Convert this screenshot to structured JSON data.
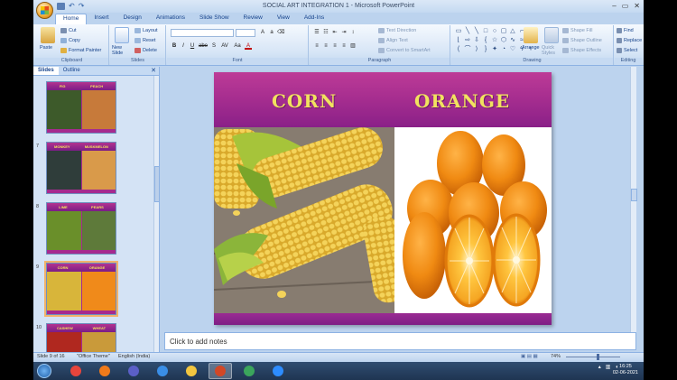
{
  "window": {
    "title": "SOCIAL ART INTEGRATION 1 - Microsoft PowerPoint",
    "controls": [
      "–",
      "▭",
      "✕"
    ]
  },
  "tabs": [
    "Home",
    "Insert",
    "Design",
    "Animations",
    "Slide Show",
    "Review",
    "View",
    "Add-Ins"
  ],
  "ribbon": {
    "clipboard": {
      "paste": "Paste",
      "cut": "Cut",
      "copy": "Copy",
      "format_painter": "Format Painter",
      "label": "Clipboard"
    },
    "slides": {
      "new_slide": "New Slide",
      "layout": "Layout",
      "reset": "Reset",
      "delete": "Delete",
      "label": "Slides"
    },
    "font": {
      "label": "Font",
      "bold": "B",
      "italic": "I",
      "underline": "U",
      "strike": "abe",
      "shadow": "S",
      "spacing": "AV",
      "case": "Aa",
      "color": "A"
    },
    "paragraph": {
      "label": "Paragraph",
      "text_direction": "Text Direction",
      "align_text": "Align Text",
      "convert_smartart": "Convert to SmartArt"
    },
    "drawing": {
      "label": "Drawing",
      "arrange": "Arrange",
      "quick_styles": "Quick Styles",
      "shape_fill": "Shape Fill",
      "shape_outline": "Shape Outline",
      "shape_effects": "Shape Effects"
    },
    "editing": {
      "label": "Editing",
      "find": "Find",
      "replace": "Replace",
      "select": "Select"
    }
  },
  "left_panel": {
    "tabs": [
      "Slides",
      "Outline"
    ],
    "thumbnails": [
      {
        "num": "",
        "left": "FIG",
        "right": "PEACH",
        "c1": "#3d5a2a",
        "c2": "#c77a3a"
      },
      {
        "num": "7",
        "left": "MONKEY",
        "right": "MUSKMELON",
        "c1": "#2f3d3a",
        "c2": "#d99a4a"
      },
      {
        "num": "8",
        "left": "LIME",
        "right": "PEARS",
        "c1": "#6a8f2a",
        "c2": "#5e7a3a"
      },
      {
        "num": "9",
        "left": "CORN",
        "right": "ORANGE",
        "c1": "#d8b53a",
        "c2": "#f08a1a"
      },
      {
        "num": "10",
        "left": "CASHEW",
        "right": "WHEAT",
        "c1": "#b0281f",
        "c2": "#c99a3a"
      }
    ]
  },
  "slide": {
    "title_left": "CORN",
    "title_right": "ORANGE"
  },
  "notes": {
    "placeholder": "Click to add notes"
  },
  "status": {
    "slide_info": "Slide 9 of 16",
    "theme": "\"Office Theme\"",
    "language": "English (India)",
    "zoom": "74%"
  },
  "taskbar": {
    "apps": [
      {
        "name": "chrome-icon",
        "color": "#e8453c"
      },
      {
        "name": "firefox-icon",
        "color": "#f07a1a"
      },
      {
        "name": "teams-icon",
        "color": "#5b5fc7"
      },
      {
        "name": "ie-icon",
        "color": "#3a8ee6"
      },
      {
        "name": "explorer-icon",
        "color": "#f2c640"
      },
      {
        "name": "powerpoint-icon",
        "color": "#d24726"
      },
      {
        "name": "chrome2-icon",
        "color": "#3ba55c"
      },
      {
        "name": "zoom-icon",
        "color": "#2d8cff"
      }
    ],
    "time": "16:25",
    "date": "02-06-2021"
  }
}
